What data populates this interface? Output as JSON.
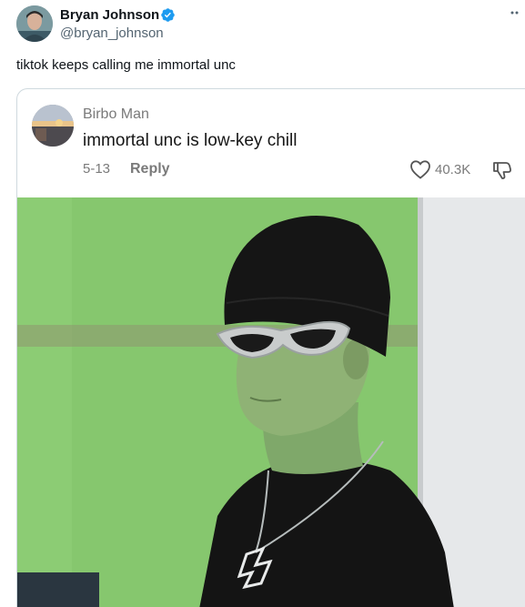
{
  "author": {
    "name": "Bryan Johnson",
    "handle": "@bryan_johnson",
    "verified": true
  },
  "tweet": {
    "text": "tiktok keeps calling me immortal unc"
  },
  "embedded_reply": {
    "name": "Birbo Man",
    "text": "immortal unc is low-key chill",
    "date": "5-13",
    "reply_label": "Reply",
    "likes": "40.3K"
  },
  "colors": {
    "verified": "#1d9bf0",
    "secondary_text": "#536471",
    "photo_background": "#7fbf6a"
  },
  "icons": [
    "more-icon",
    "verified-badge-icon",
    "heart-icon",
    "dislike-icon"
  ]
}
